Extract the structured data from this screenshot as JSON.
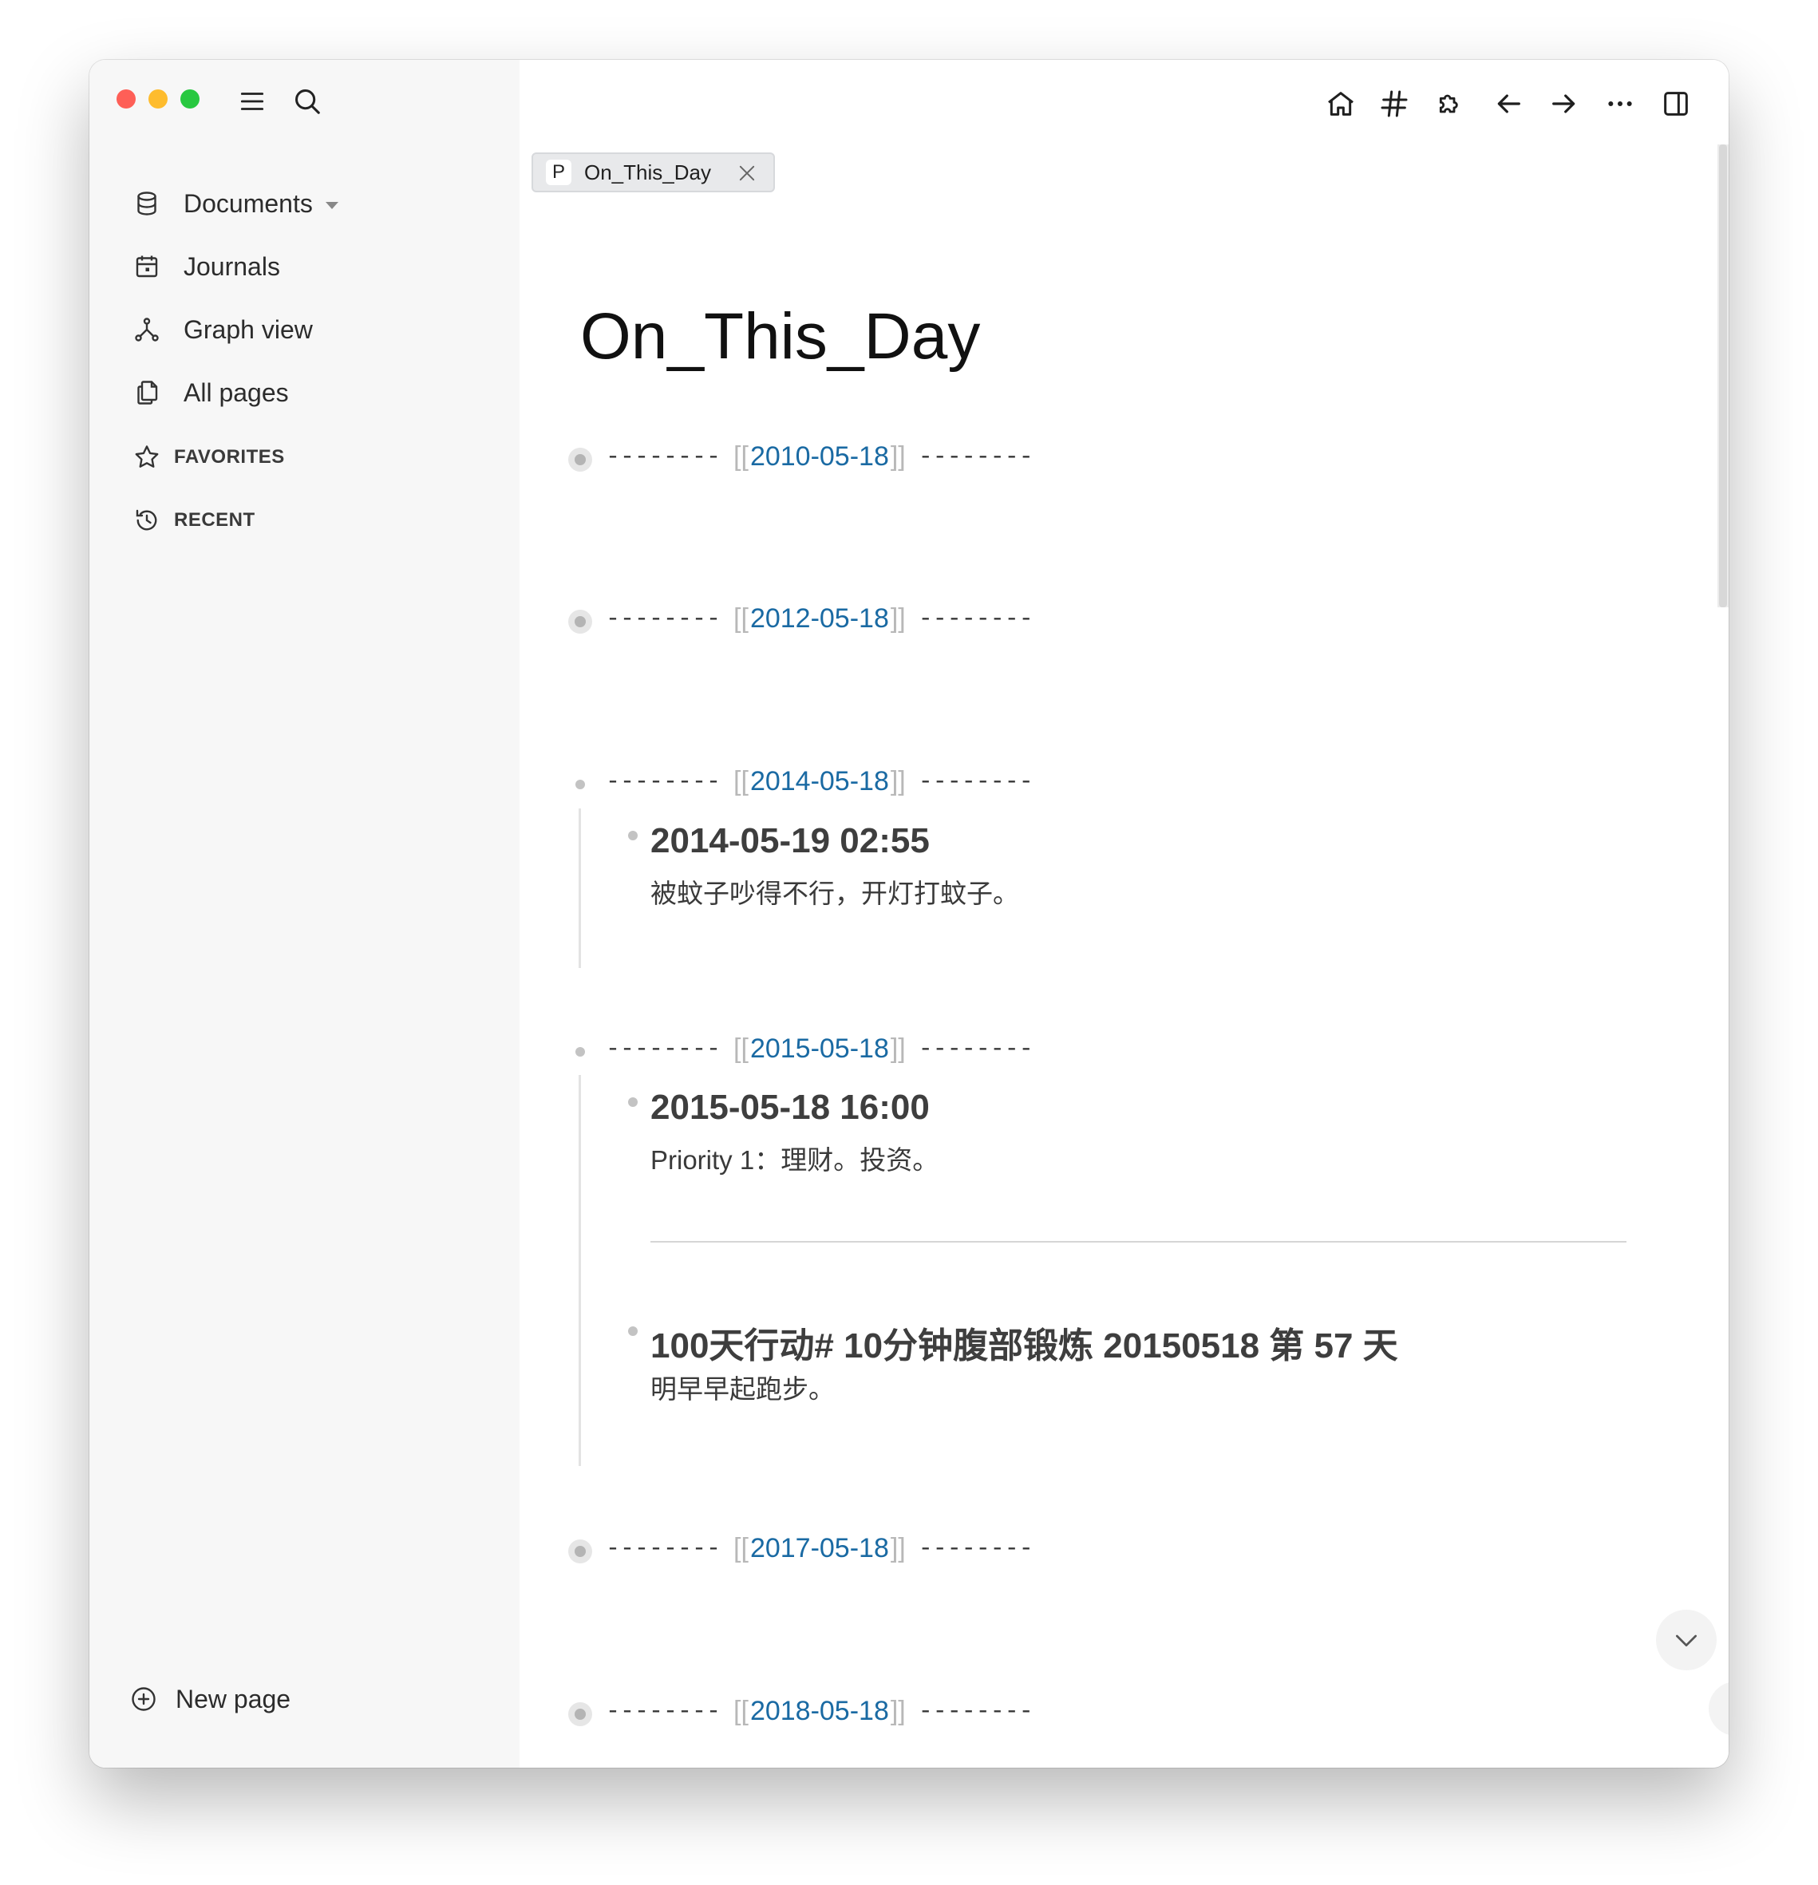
{
  "sidebar": {
    "nav": [
      {
        "label": "Documents",
        "icon": "database-icon"
      },
      {
        "label": "Journals",
        "icon": "calendar-icon"
      },
      {
        "label": "Graph view",
        "icon": "graph-icon"
      },
      {
        "label": "All pages",
        "icon": "pages-icon"
      }
    ],
    "favorites_label": "FAVORITES",
    "recent_label": "RECENT",
    "new_page_label": "New page"
  },
  "tab": {
    "badge": "P",
    "label": "On_This_Day"
  },
  "page": {
    "title": "On_This_Day",
    "dashes": "--------",
    "open_brackets": "[[",
    "close_brackets": "]]",
    "days": [
      {
        "date": "2010-05-18"
      },
      {
        "date": "2012-05-18"
      },
      {
        "date": "2014-05-18",
        "children": [
          {
            "title": "2014-05-19 02:55",
            "body": "被蚊子吵得不行，开灯打蚊子。"
          }
        ]
      },
      {
        "date": "2015-05-18",
        "children": [
          {
            "title": "2015-05-18 16:00",
            "body": "Priority 1：理财。投资。"
          },
          {
            "title": "100天行动# 10分钟腹部锻炼 20150518 第 57 天",
            "body": "明早早起跑步。"
          }
        ]
      },
      {
        "date": "2017-05-18"
      },
      {
        "date": "2018-05-18"
      }
    ]
  },
  "help_label": "?",
  "colors": {
    "link": "#1a6aa3",
    "sidebar_bg": "#f7f7f7",
    "bracket": "#b8b8b8"
  }
}
